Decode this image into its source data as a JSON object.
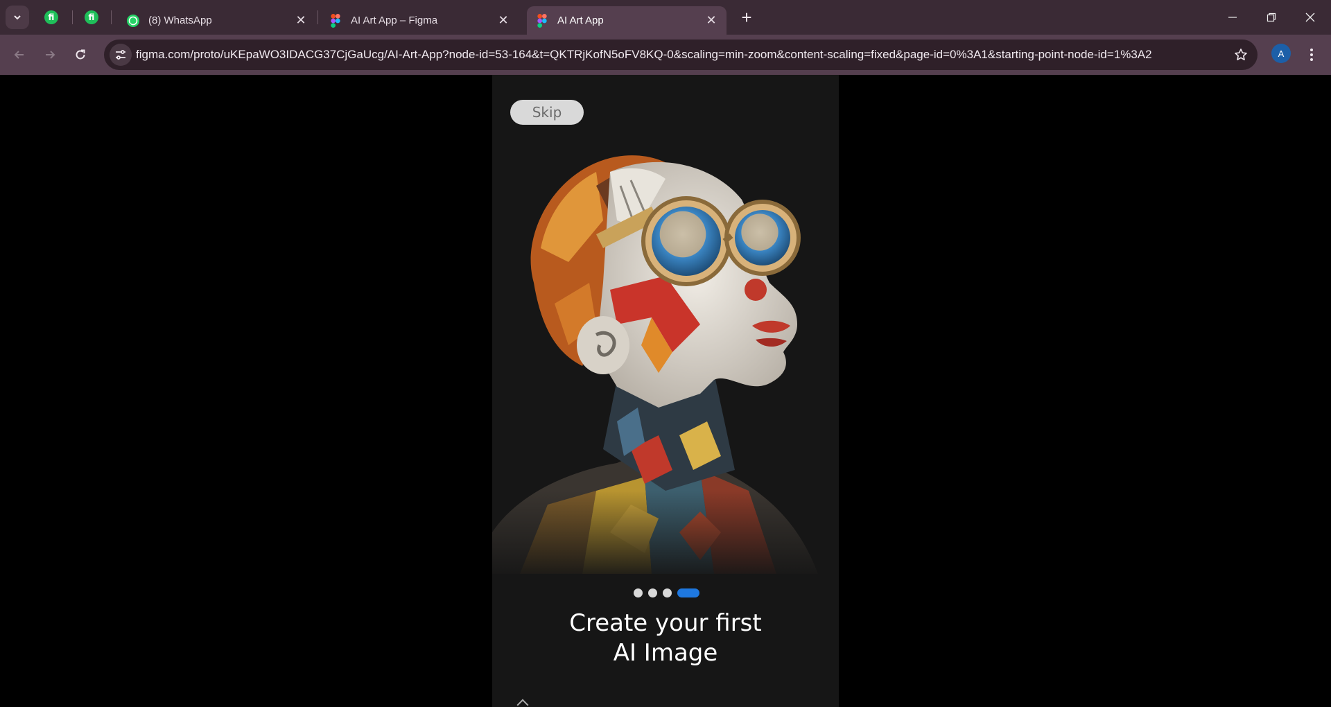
{
  "browser": {
    "tabs": [
      {
        "title": "(8) WhatsApp",
        "icon": "whatsapp-icon"
      },
      {
        "title": "AI Art App – Figma",
        "icon": "figma-icon"
      },
      {
        "title": "AI Art App",
        "icon": "figma-icon",
        "active": true
      }
    ],
    "pinned_tabs": [
      {
        "logo_text": "fi",
        "icon": "fiverr-icon"
      },
      {
        "logo_text": "fi",
        "icon": "fiverr-icon"
      }
    ],
    "new_tab_symbol": "+",
    "url": "figma.com/proto/uKEpaWO3IDACG37CjGaUcg/AI-Art-App?node-id=53-164&t=QKTRjKofN5oFV8KQ-0&scaling=min-zoom&content-scaling=fixed&page-id=0%3A1&starting-point-node-id=1%3A2",
    "profile_initial": "A",
    "colors": {
      "tab_strip": "#3a2a35",
      "toolbar": "#553f4f",
      "profile": "#1c5fa8"
    }
  },
  "screen": {
    "skip_label": "Skip",
    "headline_line1": "Create your first",
    "headline_line2": "AI Image",
    "pagination": {
      "total": 4,
      "active_index": 3,
      "active_color": "#1e78e0"
    },
    "hero_image": "clown-portrait-illustration"
  }
}
